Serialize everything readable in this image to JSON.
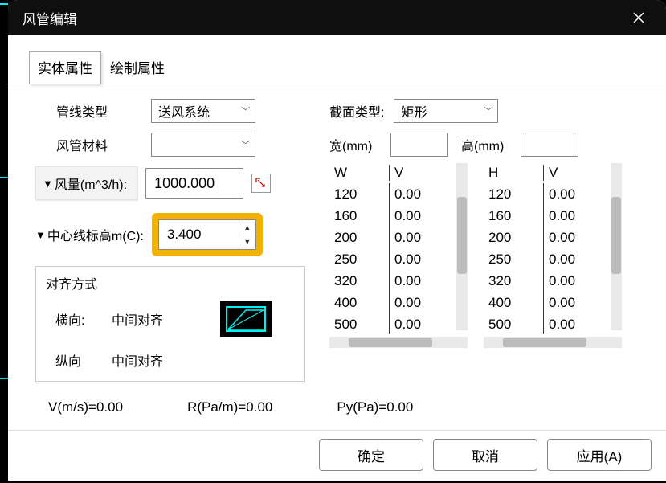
{
  "window": {
    "title": "风管编辑"
  },
  "tabs": [
    {
      "label": "实体属性"
    },
    {
      "label": "绘制属性"
    }
  ],
  "labels": {
    "pipeType": "管线类型",
    "ductMaterial": "风管材料",
    "sectionType": "截面类型:",
    "width": "宽(mm)",
    "height": "高(mm)",
    "airflow": "风量(m^3/h):",
    "centerElev": "中心线标高m(C):",
    "alignGroup": "对齐方式",
    "horizLabel": "横向:",
    "vertLabel": "纵向"
  },
  "inputs": {
    "pipeType": "送风系统",
    "ductMaterial": "",
    "sectionType": "矩形",
    "width": "",
    "height": "",
    "airflow": "1000.000",
    "centerElev": "3.400",
    "horizAlign": "中间对齐",
    "vertAlign": "中间对齐"
  },
  "tableW": {
    "headers": [
      "W",
      "V"
    ],
    "rows": [
      [
        "120",
        "0.00"
      ],
      [
        "160",
        "0.00"
      ],
      [
        "200",
        "0.00"
      ],
      [
        "250",
        "0.00"
      ],
      [
        "320",
        "0.00"
      ],
      [
        "400",
        "0.00"
      ],
      [
        "500",
        "0.00"
      ]
    ]
  },
  "tableH": {
    "headers": [
      "H",
      "V"
    ],
    "rows": [
      [
        "120",
        "0.00"
      ],
      [
        "160",
        "0.00"
      ],
      [
        "200",
        "0.00"
      ],
      [
        "250",
        "0.00"
      ],
      [
        "320",
        "0.00"
      ],
      [
        "400",
        "0.00"
      ],
      [
        "500",
        "0.00"
      ]
    ]
  },
  "stats": {
    "v": "V(m/s)=0.00",
    "r": "R(Pa/m)=0.00",
    "py": "Py(Pa)=0.00"
  },
  "buttons": {
    "ok": "确定",
    "cancel": "取消",
    "apply": "应用(A)"
  }
}
